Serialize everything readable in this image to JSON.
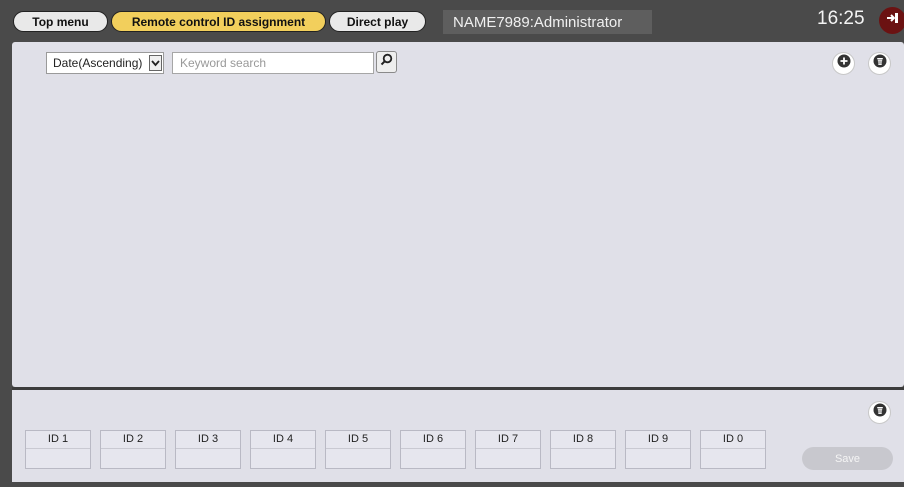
{
  "nav": {
    "top_menu": "Top menu",
    "remote_control_id_assignment": "Remote control ID assignment",
    "direct_play": "Direct play"
  },
  "user": {
    "label": "NAME7989:Administrator"
  },
  "clock": {
    "time": "16:25"
  },
  "toolbar": {
    "sort_value": "Date(Ascending)",
    "search_placeholder": "Keyword search"
  },
  "id_slots": [
    "ID 1",
    "ID 2",
    "ID 3",
    "ID 4",
    "ID 5",
    "ID 6",
    "ID 7",
    "ID 8",
    "ID 9",
    "ID 0"
  ],
  "save_label": "Save",
  "colors": {
    "active_tab": "#f2cf5c",
    "panel": "#e0e0e8",
    "frame": "#4a4a4a",
    "logout": "#6b1212"
  }
}
